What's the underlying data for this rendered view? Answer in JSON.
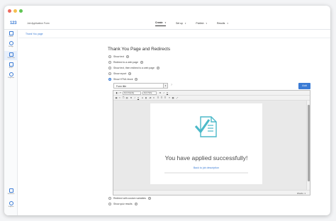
{
  "app": {
    "logo": "123",
    "title": "Job Application Form"
  },
  "topnav": [
    {
      "label": "Create",
      "active": true
    },
    {
      "label": "Set up",
      "active": false
    },
    {
      "label": "Publish",
      "active": false
    },
    {
      "label": "Results",
      "active": false
    }
  ],
  "sidebar": {
    "items": [
      {
        "label": "Fields",
        "icon": "plus-icon"
      },
      {
        "label": "Design",
        "icon": "palette-icon"
      },
      {
        "label": "Thank You",
        "icon": "document-icon",
        "active": true
      },
      {
        "label": "Rules",
        "icon": "branch-icon"
      },
      {
        "label": "Payment",
        "icon": "coin-icon"
      }
    ],
    "bottom": [
      {
        "label": "Feedback",
        "icon": "chat-icon"
      },
      {
        "label": "Support",
        "icon": "help-icon"
      }
    ]
  },
  "breadcrumb": "Thank You page",
  "section": {
    "heading": "Thank You Page and Redirects",
    "options": [
      {
        "label": "Show text",
        "selected": false
      },
      {
        "label": "Redirect to a web page",
        "selected": false
      },
      {
        "label": "Show text, then redirect to a web page",
        "selected": false
      },
      {
        "label": "Show report",
        "selected": false
      },
      {
        "label": "Show HTML block",
        "selected": true
      }
    ],
    "bottom_options": [
      {
        "label": "Redirect with custom variables",
        "selected": false
      },
      {
        "label": "Show quiz results",
        "selected": false
      }
    ]
  },
  "html_block": {
    "select_value": "Form title",
    "add_label": "Add",
    "help": "?"
  },
  "editor": {
    "font_family": "Font Family",
    "font_size": "Font Size",
    "preview_title": "You have applied successfully!",
    "preview_link": "Back to job description",
    "status": "Words: 1",
    "accent": "#3a7bd5",
    "icon_color": "#4bb9c9"
  }
}
